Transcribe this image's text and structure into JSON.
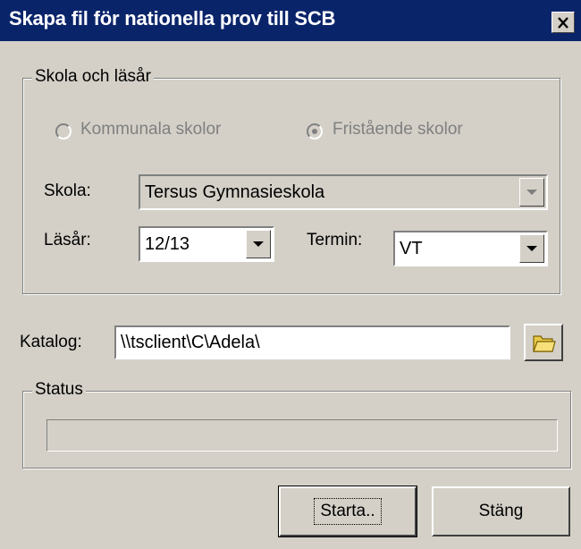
{
  "window": {
    "title": "Skapa fil för nationella prov till SCB",
    "close_label": "✕"
  },
  "school_group": {
    "legend": "Skola och läsår",
    "radio_kommunala": "Kommunala skolor",
    "radio_fristaende": "Fristående skolor",
    "selected_radio": "Fristående skolor",
    "skola_label": "Skola:",
    "skola_value": "Tersus Gymnasieskola",
    "lasar_label": "Läsår:",
    "lasar_value": "12/13",
    "termin_label": "Termin:",
    "termin_value": "VT"
  },
  "katalog": {
    "label": "Katalog:",
    "value": "\\\\tsclient\\C\\Adela\\"
  },
  "status_group": {
    "legend": "Status",
    "progress": 0
  },
  "buttons": {
    "start": "Starta..",
    "close": "Stäng"
  },
  "icons": {
    "folder": "folder-icon",
    "close": "close-icon",
    "dropdown": "chevron-down-icon"
  },
  "colors": {
    "titlebar": "#0a246a",
    "face": "#d4d0c8",
    "disabled_text": "#808080"
  }
}
